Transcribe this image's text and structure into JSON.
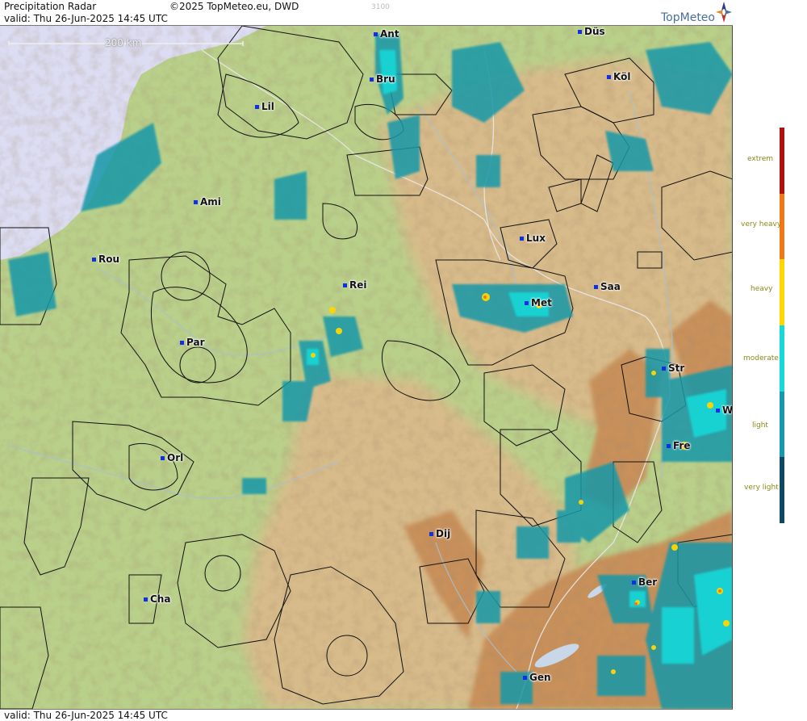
{
  "header": {
    "title": "Precipitation Radar",
    "copyright": "©2025 TopMeteo.eu, DWD",
    "code": "3100",
    "valid": "valid:  Thu   26-Jun-2025 14:45 UTC",
    "logo": "TopMeteo"
  },
  "footer": {
    "valid": "valid:  Thu   26-Jun-2025 14:45 UTC"
  },
  "scale": {
    "label": "200 km"
  },
  "cities": [
    {
      "id": "ant",
      "label": "Ant"
    },
    {
      "id": "dus",
      "label": "Düs"
    },
    {
      "id": "bru",
      "label": "Bru"
    },
    {
      "id": "kol",
      "label": "Köl"
    },
    {
      "id": "lil",
      "label": "Lil"
    },
    {
      "id": "ami",
      "label": "Ami"
    },
    {
      "id": "rou",
      "label": "Rou"
    },
    {
      "id": "lux",
      "label": "Lux"
    },
    {
      "id": "rei",
      "label": "Rei"
    },
    {
      "id": "saa",
      "label": "Saa"
    },
    {
      "id": "met",
      "label": "Met"
    },
    {
      "id": "par",
      "label": "Par"
    },
    {
      "id": "str",
      "label": "Str"
    },
    {
      "id": "w",
      "label": "W"
    },
    {
      "id": "fre",
      "label": "Fre"
    },
    {
      "id": "orl",
      "label": "Orl"
    },
    {
      "id": "dij",
      "label": "Dij"
    },
    {
      "id": "ber",
      "label": "Ber"
    },
    {
      "id": "cha",
      "label": "Cha"
    },
    {
      "id": "gen",
      "label": "Gen"
    }
  ],
  "legend": {
    "levels": [
      {
        "label": "extrem",
        "color": "#b01010"
      },
      {
        "label": "very heavy",
        "color": "#f07818"
      },
      {
        "label": "heavy",
        "color": "#ffd700"
      },
      {
        "label": "moderate",
        "color": "#18d8d8"
      },
      {
        "label": "light",
        "color": "#1898a8"
      },
      {
        "label": "very light",
        "color": "#104860"
      }
    ]
  },
  "colors": {
    "sea": "#dcdcf2",
    "lowland": "#b9d08a",
    "upland": "#d8bb8a",
    "mountain": "#c8905a",
    "lake": "#c8d8e8"
  }
}
